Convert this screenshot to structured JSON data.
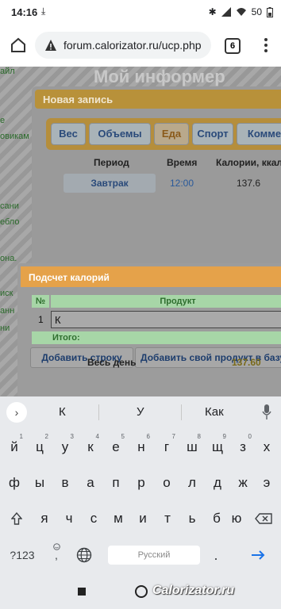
{
  "status_bar": {
    "time": "14:16",
    "battery": "50"
  },
  "browser": {
    "url": "forum.calorizator.ru/ucp.php",
    "tab_count": "6"
  },
  "page": {
    "informer_title": "Мой информер",
    "left_links": [
      "айл",
      "е",
      "овикам",
      "сани",
      "ебло",
      "она.",
      "иск",
      "анн",
      "ни"
    ],
    "new_entry": {
      "header": "Новая запись",
      "tabs": [
        {
          "label": "Вес"
        },
        {
          "label": "Объемы"
        },
        {
          "label": "Еда",
          "active": true
        },
        {
          "label": "Спорт"
        },
        {
          "label": "Комме"
        }
      ],
      "columns": {
        "period": "Период",
        "time": "Время",
        "calories": "Калории, ккал"
      },
      "rows": [
        {
          "period": "Завтрак",
          "time": "12:00",
          "calories": "137.6"
        }
      ],
      "all_day_label": "Весь день",
      "all_day_value": "137.60"
    },
    "calorie_dialog": {
      "header": "Подсчет калорий",
      "col_num": "№",
      "col_product": "Продукт",
      "rows": [
        {
          "num": "1",
          "value": "К"
        }
      ],
      "total_label": "Итого:",
      "add_row_button": "Добавить строку",
      "add_product_button": "Добавить свой продукт в базу"
    }
  },
  "keyboard": {
    "suggestions": [
      "К",
      "У",
      "Как"
    ],
    "row1": [
      {
        "key": "й",
        "sup": "1"
      },
      {
        "key": "ц",
        "sup": "2"
      },
      {
        "key": "у",
        "sup": "3"
      },
      {
        "key": "к",
        "sup": "4"
      },
      {
        "key": "е",
        "sup": "5"
      },
      {
        "key": "н",
        "sup": "6"
      },
      {
        "key": "г",
        "sup": "7"
      },
      {
        "key": "ш",
        "sup": "8"
      },
      {
        "key": "щ",
        "sup": "9"
      },
      {
        "key": "з",
        "sup": "0"
      },
      {
        "key": "х",
        "sup": ""
      }
    ],
    "row2": [
      "ф",
      "ы",
      "в",
      "а",
      "п",
      "р",
      "о",
      "л",
      "д",
      "ж",
      "э"
    ],
    "row3": [
      "я",
      "ч",
      "с",
      "м",
      "и",
      "т",
      "ь",
      "б",
      "ю"
    ],
    "symbols_key": "?123",
    "emoji_key": ",",
    "space_label": "Русский",
    "period_key": ".",
    "enter_color": "#1a73e8"
  },
  "watermark": "Calorizator.ru"
}
